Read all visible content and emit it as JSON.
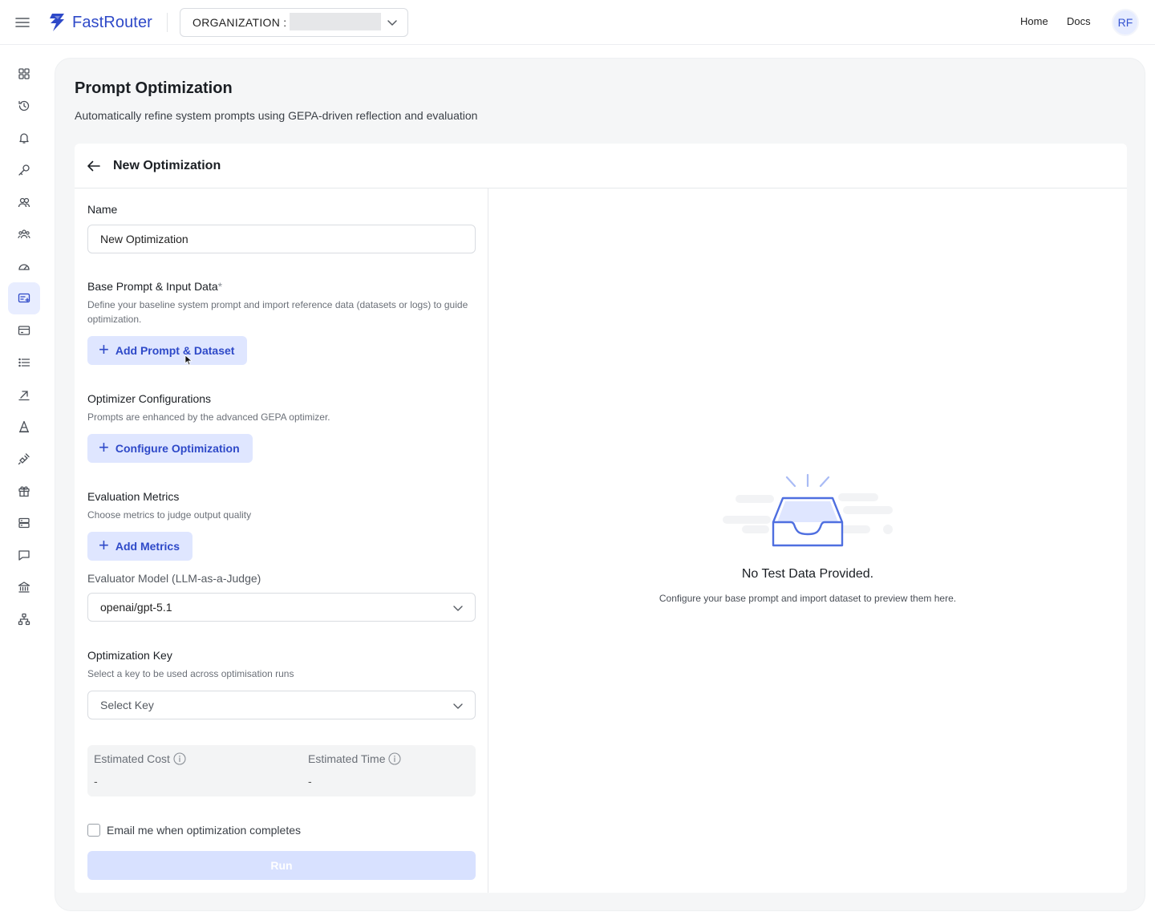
{
  "header": {
    "brand": "FastRouter",
    "org_label": "ORGANIZATION :",
    "nav": {
      "home": "Home",
      "docs": "Docs"
    },
    "avatar_initials": "RF"
  },
  "sidebar": {
    "items": [
      {
        "icon": "grid-icon"
      },
      {
        "icon": "history-icon"
      },
      {
        "icon": "bell-icon"
      },
      {
        "icon": "key-icon"
      },
      {
        "icon": "users-icon"
      },
      {
        "icon": "team-icon"
      },
      {
        "icon": "gauge-icon"
      },
      {
        "icon": "prompt-optimize-icon",
        "active": true
      },
      {
        "icon": "credit-card-icon"
      },
      {
        "icon": "list-icon"
      },
      {
        "icon": "arrow-up-right-icon"
      },
      {
        "icon": "model-icon"
      },
      {
        "icon": "plug-icon"
      },
      {
        "icon": "gift-icon"
      },
      {
        "icon": "server-icon"
      },
      {
        "icon": "chat-icon"
      },
      {
        "icon": "bank-icon"
      },
      {
        "icon": "network-icon"
      }
    ]
  },
  "page": {
    "title": "Prompt Optimization",
    "subtitle": "Automatically refine system prompts using GEPA-driven reflection and evaluation"
  },
  "card": {
    "title": "New Optimization"
  },
  "form": {
    "name_label": "Name",
    "name_value": "New Optimization",
    "base_prompt_label": "Base Prompt & Input Data",
    "base_prompt_required": "*",
    "base_prompt_help": "Define your baseline system prompt and import reference data (datasets or logs) to guide optimization.",
    "add_prompt_button": "Add Prompt & Dataset",
    "optimizer_label": "Optimizer Configurations",
    "optimizer_help": "Prompts are enhanced by the advanced GEPA optimizer.",
    "configure_button": "Configure Optimization",
    "metrics_label": "Evaluation Metrics",
    "metrics_help": "Choose metrics to judge output quality",
    "add_metrics_button": "Add Metrics",
    "evaluator_label": "Evaluator Model (LLM-as-a-Judge)",
    "evaluator_value": "openai/gpt-5.1",
    "key_label": "Optimization Key",
    "key_help": "Select a key to be used across optimisation runs",
    "key_placeholder": "Select Key",
    "estimated_cost_label": "Estimated Cost",
    "estimated_cost_value": "-",
    "estimated_time_label": "Estimated Time",
    "estimated_time_value": "-",
    "email_label": "Email me when optimization completes",
    "email_checked": false,
    "run_button": "Run"
  },
  "empty_state": {
    "title": "No Test Data Provided.",
    "subtitle": "Configure your base prompt and import dataset to preview them here."
  },
  "colors": {
    "brand": "#2e49c8",
    "accent_soft": "#dfe6ff",
    "run_disabled": "#d8e1ff"
  }
}
